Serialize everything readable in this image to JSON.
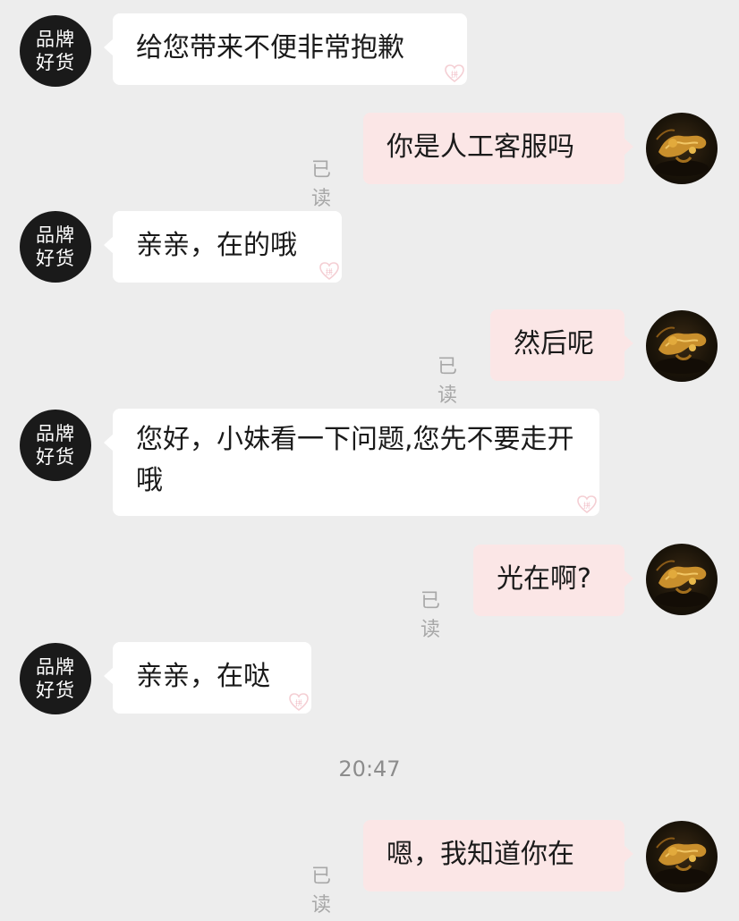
{
  "shop": {
    "avatar_line1": "品牌",
    "avatar_line2": "好货"
  },
  "messages": [
    {
      "side": "left",
      "text": "给您带来不便非常抱歉"
    },
    {
      "side": "right",
      "text": "你是人工客服吗",
      "read": "已读"
    },
    {
      "side": "left",
      "text": "亲亲，在的哦"
    },
    {
      "side": "right",
      "text": "然后呢",
      "read": "已读"
    },
    {
      "side": "left",
      "text": "您好，小妹看一下问题,您先不要走开哦"
    },
    {
      "side": "right",
      "text": "光在啊?",
      "read": "已读"
    },
    {
      "side": "left",
      "text": "亲亲，在哒"
    },
    {
      "side": "right",
      "text": "嗯，我知道你在",
      "read": "已读"
    }
  ],
  "timestamp": "20:47",
  "colors": {
    "background": "#ededed",
    "left_bubble": "#ffffff",
    "right_bubble": "#fbe6e6",
    "read_text": "#a8a8a8"
  },
  "icons": {
    "shop_avatar": "brand-logo-avatar",
    "user_avatar": "dragon-avatar",
    "bubble_mark": "heart-mark-icon"
  }
}
